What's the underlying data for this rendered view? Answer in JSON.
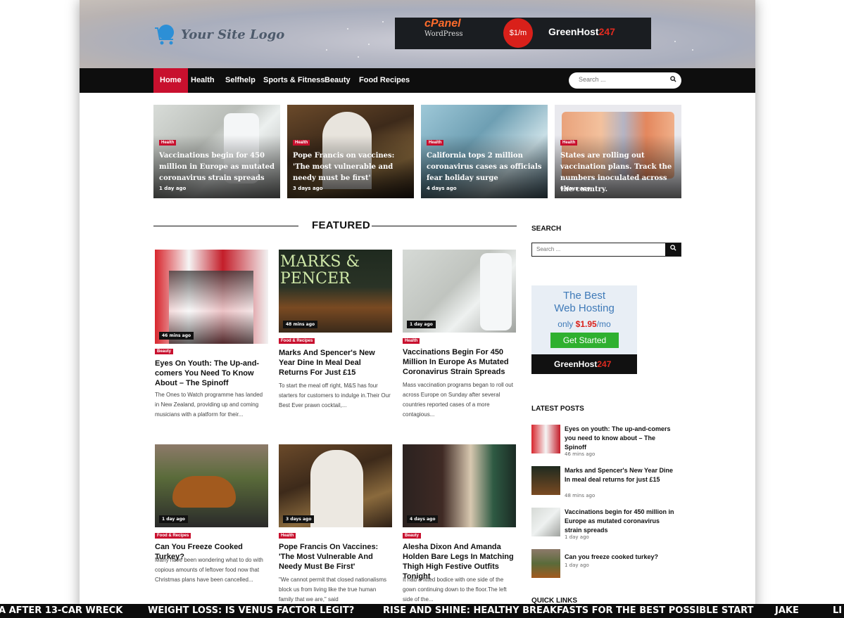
{
  "site": {
    "logo_text": "Your Site Logo",
    "banner": {
      "cpanel": "cPanel",
      "wordpress": "WordPress",
      "price": "$1/m",
      "host_a": "GreenHost",
      "host_b": "247"
    }
  },
  "nav": {
    "items": [
      {
        "label": "Home"
      },
      {
        "label": "Health"
      },
      {
        "label": "Selfhelp"
      },
      {
        "label": "Sports & Fitness"
      },
      {
        "label": "Beauty"
      },
      {
        "label": "Food Recipes"
      }
    ],
    "search_placeholder": "Search ..."
  },
  "hero": [
    {
      "tag": "Health",
      "title": "Vaccinations begin for 450 million in Europe as mutated coronavirus strain spreads",
      "time": "1 day ago"
    },
    {
      "tag": "Health",
      "title": "Pope Francis on vaccines: 'The most vulnerable and needy must be first'",
      "time": "3 days ago"
    },
    {
      "tag": "Health",
      "title": "California tops 2 million coronavirus cases as officials fear holiday surge",
      "time": "4 days ago"
    },
    {
      "tag": "Health",
      "title": "States are rolling out vaccination plans. Track the numbers inoculated across the country.",
      "time": "6 days ago"
    }
  ],
  "featured": {
    "heading": "FEATURED",
    "cards": [
      {
        "badge": "46 mins ago",
        "tag": "Beauty",
        "title": "Eyes On Youth: The Up-and-comers You Need To Know About – The Spinoff",
        "excerpt": "The Ones to Watch programme has landed in New Zealand, providing up and coming musicians with a platform for their..."
      },
      {
        "badge": "48 mins ago",
        "tag": "Food & Recipes",
        "title": "Marks And Spencer's New Year Dine In Meal Deal Returns For Just £15",
        "excerpt": "To start the meal off right, M&S has four starters for customers to indulge in.Their Our Best Ever prawn cocktail,..."
      },
      {
        "badge": "1 day ago",
        "tag": "Health",
        "title": "Vaccinations Begin For 450 Million In Europe As Mutated Coronavirus Strain Spreads",
        "excerpt": "Mass vaccination programs began to roll out across Europe on Sunday after several countries reported cases of a more contagious..."
      },
      {
        "badge": "1 day ago",
        "tag": "Food & Recipes",
        "title": "Can You Freeze Cooked Turkey?",
        "excerpt": "Many have been wondering what to do with copious amounts of leftover food now that Christmas plans have been cancelled..."
      },
      {
        "badge": "3 days ago",
        "tag": "Health",
        "title": "Pope Francis On Vaccines: 'The Most Vulnerable And Needy Must Be First'",
        "excerpt": "\"We cannot permit that closed nationalisms block us from living like the true human family that we are,\" said"
      },
      {
        "badge": "4 days ago",
        "tag": "Beauty",
        "title": "Alesha Dixon And Amanda Holden Bare Legs In Matching Thigh High Festive Outfits Tonight",
        "excerpt": "It had a fitted bodice with one side of the gown continuing down to the floor.The left side of the..."
      }
    ]
  },
  "sidebar": {
    "search_heading": "SEARCH",
    "search_placeholder": "Search ...",
    "ad": {
      "line1": "The Best",
      "line2": "Web Hosting",
      "only": "only",
      "price": "$1.95",
      "per": "/mo",
      "cta": "Get Started",
      "brand_a": "GreenHost",
      "brand_b": "247"
    },
    "latest_heading": "LATEST POSTS",
    "latest": [
      {
        "title": "Eyes on youth: The up-and-comers you need to know about – The Spinoff",
        "time": "46 mins ago"
      },
      {
        "title": "Marks and Spencer's New Year Dine In meal deal returns for just £15",
        "time": "48 mins ago"
      },
      {
        "title": "Vaccinations begin for 450 million in Europe as mutated coronavirus strain spreads",
        "time": "1 day ago"
      },
      {
        "title": "Can you freeze cooked turkey?",
        "time": "1 day ago"
      }
    ],
    "quick_links_heading": "QUICK LINKS"
  },
  "ticker": [
    "A AFTER 13-CAR WRECK",
    "WEIGHT LOSS: IS VENUS FACTOR LEGIT?",
    "RISE AND SHINE: HEALTHY BREAKFASTS FOR THE BEST POSSIBLE START",
    "JAKE",
    "LI"
  ]
}
